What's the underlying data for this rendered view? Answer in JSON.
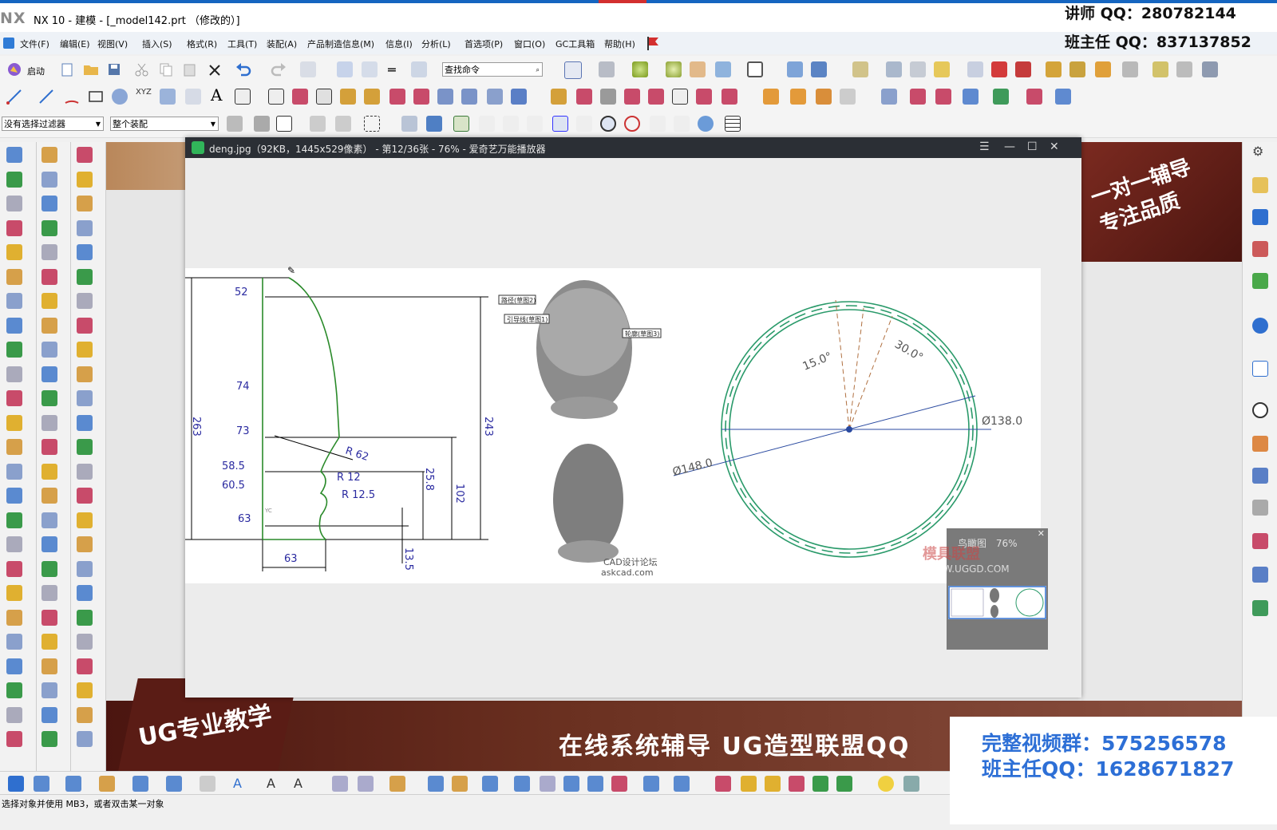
{
  "titlebar": {
    "logo": "NX",
    "title": "NX 10 - 建模 - [_model142.prt （修改的）]",
    "teacher_qq": "讲师 QQ：280782144",
    "class_qq": "班主任 QQ：837137852"
  },
  "menu": [
    "文件(F)",
    "编辑(E)",
    "视图(V)",
    "插入(S)",
    "格式(R)",
    "工具(T)",
    "装配(A)",
    "产品制造信息(M)",
    "信息(I)",
    "分析(L)",
    "首选项(P)",
    "窗口(O)",
    "GC工具箱",
    "帮助(H)"
  ],
  "toolbar": {
    "start_label": "启动",
    "find_command_placeholder": "查找命令",
    "filter_select": "没有选择过滤器",
    "assembly_select": "整个装配"
  },
  "viewer": {
    "title": "deng.jpg（92KB，1445x529像素） - 第12/36张 - 76% - 爱奇艺万能播放器",
    "birdseye_label": "鸟瞰图",
    "birdseye_zoom": "76%"
  },
  "drawing": {
    "dims_left": [
      "52",
      "74",
      "73",
      "58.5",
      "60.5",
      "63"
    ],
    "dim_bottom": "63",
    "dim_height_left": "263",
    "dim_height_right": "243",
    "dim_102": "102",
    "dim_25_8": "25.8",
    "dim_13_5": "13.5",
    "radii": [
      "R 62",
      "R 12",
      "R 12.5"
    ],
    "yc_label": "YC",
    "callouts": [
      "路径(草图2)",
      "引导线(草图1)",
      "轮廓(草图3)"
    ],
    "watermark1": "CAD设计论坛",
    "watermark2": "askcad.com",
    "angle1": "15.0°",
    "angle2": "30.0°",
    "dia_outer": "Ø148.0",
    "dia_inner": "Ø138.0",
    "watermark3": "模具联盟",
    "watermark4": "WWW.UGGD.COM"
  },
  "banners": {
    "right": "一对一辅导\n专注品质",
    "bottom_left": "UG专业教学",
    "bottom": "在线系统辅导  UG造型联盟QQ"
  },
  "info": {
    "group": "完整视频群：575256578",
    "class_qq": "班主任QQ：1628671827"
  },
  "status": {
    "text": "选择对象并使用 MB3，或者双击某一对象"
  }
}
